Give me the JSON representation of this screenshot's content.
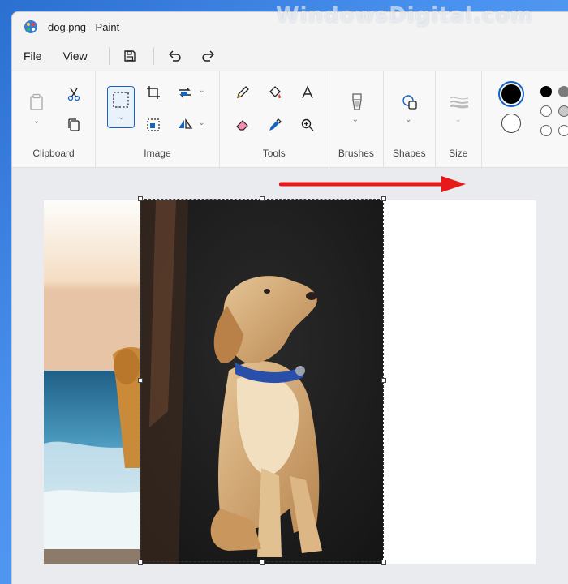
{
  "watermark": "WindowsDigital.com",
  "window": {
    "title": "dog.png - Paint"
  },
  "menu": {
    "file": "File",
    "view": "View"
  },
  "ribbon": {
    "groups": {
      "clipboard": "Clipboard",
      "image": "Image",
      "tools": "Tools",
      "brushes": "Brushes",
      "shapes": "Shapes",
      "size": "Size"
    }
  },
  "colors": {
    "primary": "#000000",
    "secondary": "#ffffff",
    "arrow": "#e8191b"
  },
  "icons": [
    "paint-app-icon",
    "save-icon",
    "undo-icon",
    "redo-icon",
    "paste-icon",
    "cut-icon",
    "copy-icon",
    "select-icon",
    "crop-icon",
    "resize-icon",
    "rotate-icon",
    "flip-icon",
    "pencil-icon",
    "fill-icon",
    "text-icon",
    "eraser-icon",
    "color-picker-icon",
    "magnifier-icon",
    "brush-icon",
    "shapes-icon",
    "size-icon"
  ]
}
